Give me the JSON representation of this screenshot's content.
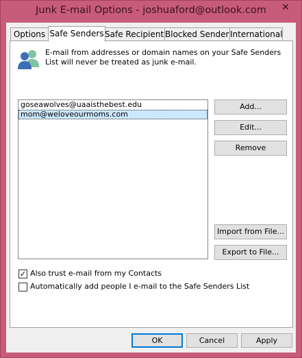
{
  "window": {
    "title": "Junk E-mail Options - joshuaford@outlook.com",
    "close_glyph": "✕"
  },
  "tabs": [
    {
      "label": "Options",
      "active": false
    },
    {
      "label": "Safe Senders",
      "active": true
    },
    {
      "label": "Safe Recipients",
      "active": false
    },
    {
      "label": "Blocked Senders",
      "active": false
    },
    {
      "label": "International",
      "active": false
    }
  ],
  "safe_senders": {
    "icon": "people-icon",
    "description": "E-mail from addresses or domain names on your Safe Senders List will never be treated as junk e-mail.",
    "list": [
      {
        "address": "goseawolves@uaaisthebest.edu",
        "selected": false
      },
      {
        "address": "mom@weloveourmoms.com",
        "selected": true
      }
    ],
    "buttons": {
      "add": "Add...",
      "edit": "Edit...",
      "remove": "Remove",
      "import": "Import from File...",
      "export": "Export to File..."
    },
    "checkboxes": {
      "trust_contacts": {
        "label": "Also trust e-mail from my Contacts",
        "checked": true
      },
      "auto_add": {
        "label": "Automatically add people I e-mail to the Safe Senders List",
        "checked": false
      }
    }
  },
  "dialog_buttons": {
    "ok": "OK",
    "cancel": "Cancel",
    "apply": "Apply"
  },
  "colors": {
    "frame": "#c75b7a",
    "selection": "#cce8ff",
    "default_button_border": "#0078d7"
  }
}
